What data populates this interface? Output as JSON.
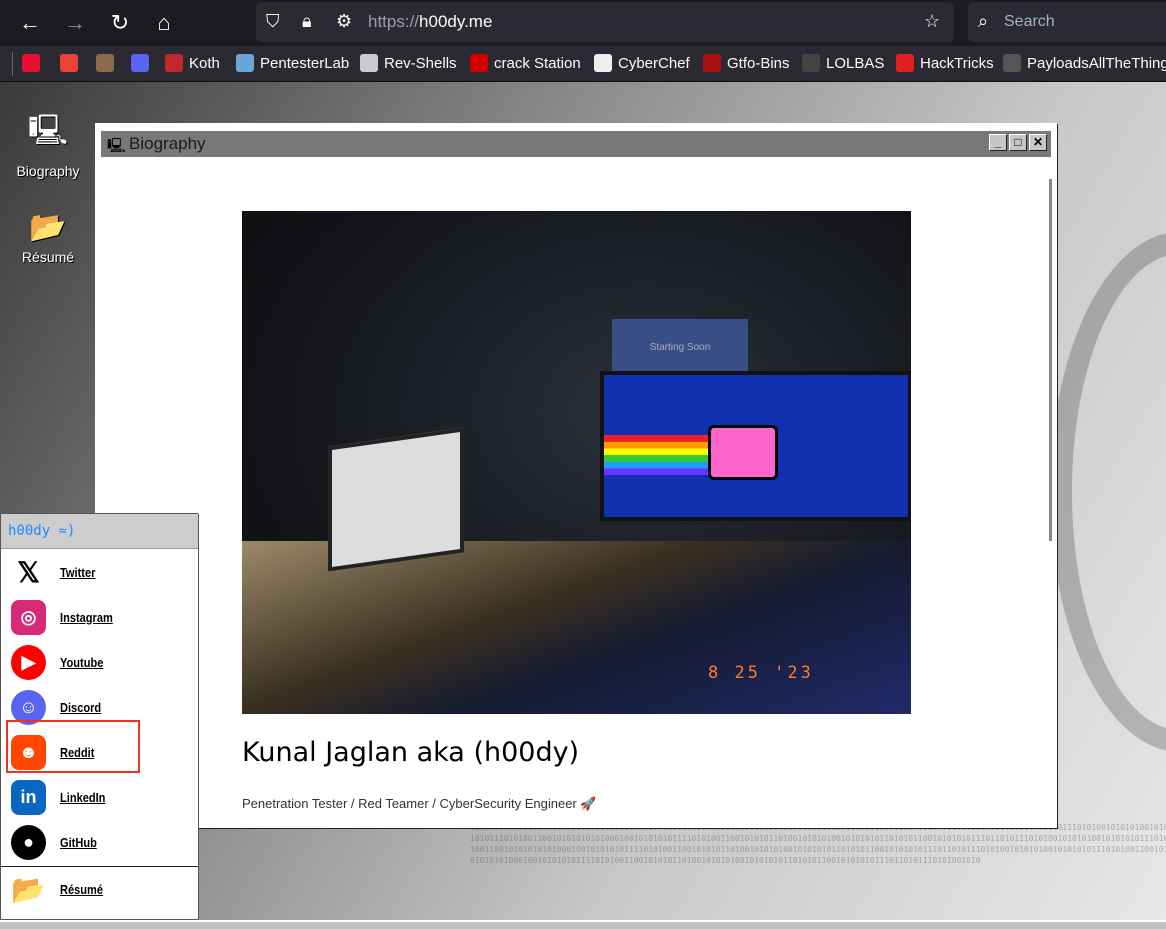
{
  "browser": {
    "url_scheme": "https://",
    "url_host": "h00dy.me",
    "search_placeholder": "Search",
    "bookmarks": [
      {
        "label": "",
        "color": "#e5112e"
      },
      {
        "label": "",
        "color": "#ea4335"
      },
      {
        "label": "",
        "color": "#8a6a4a"
      },
      {
        "label": "",
        "color": "#5865f2"
      },
      {
        "label": "Koth",
        "color": "#c0282d"
      },
      {
        "label": "PentesterLab",
        "color": "#6aa7d8"
      },
      {
        "label": "Rev-Shells",
        "color": "#cccccc"
      },
      {
        "label": "crack Station",
        "color": "#d00000"
      },
      {
        "label": "CyberChef",
        "color": "#eeeeee"
      },
      {
        "label": "Gtfo-Bins",
        "color": "#aa1111"
      },
      {
        "label": "LOLBAS",
        "color": "#444444"
      },
      {
        "label": "HackTricks",
        "color": "#e02020"
      },
      {
        "label": "PayloadsAllTheThings",
        "color": "#555555"
      }
    ]
  },
  "desktop": {
    "icons": [
      {
        "label": "Biography"
      },
      {
        "label": "Résumé"
      }
    ]
  },
  "window": {
    "title": "Biography",
    "photo": {
      "projector_text": "Starting Soon",
      "date_stamp": "8 25 '23"
    },
    "heading": "Kunal Jaglan aka (h00dy)",
    "subtitle": "Penetration Tester / Red Teamer / CyberSecurity Engineer 🚀"
  },
  "start_menu": {
    "header": "h00dy ≈)",
    "items": [
      {
        "label": "Twitter",
        "color": "#ffffff"
      },
      {
        "label": "Instagram",
        "color": "#d62976"
      },
      {
        "label": "Youtube",
        "color": "#ff0000"
      },
      {
        "label": "Discord",
        "color": "#5865f2"
      },
      {
        "label": "Reddit",
        "color": "#ff4500"
      },
      {
        "label": "LinkedIn",
        "color": "#0a66c2"
      },
      {
        "label": "GitHub",
        "color": "#000000"
      }
    ],
    "resume_label": "Résumé",
    "highlighted": "Reddit"
  }
}
